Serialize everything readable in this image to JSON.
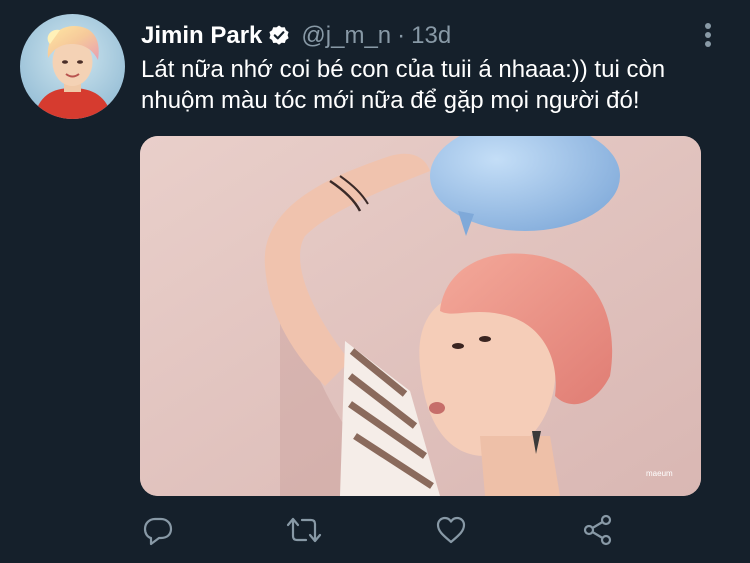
{
  "tweet": {
    "author": {
      "display_name": "Jimin Park",
      "handle": "@j_m_n",
      "verified": true,
      "avatar_icon": "profile-avatar"
    },
    "separator": "·",
    "time": "13d",
    "text_line1": "Lát nữa nhớ coi bé con của tuii á nhaaa:)) tui còn",
    "text_line2": "nhuộm màu tóc mới nữa để gặp mọi người đó!",
    "media": {
      "watermark": "maeum"
    }
  },
  "actions": [
    {
      "icon": "reply-icon"
    },
    {
      "icon": "retweet-icon"
    },
    {
      "icon": "like-icon"
    },
    {
      "icon": "share-icon"
    }
  ],
  "colors": {
    "background": "#15202b",
    "text": "#ffffff",
    "secondary_text": "#8899a6",
    "verified_badge": "#ffffff"
  }
}
